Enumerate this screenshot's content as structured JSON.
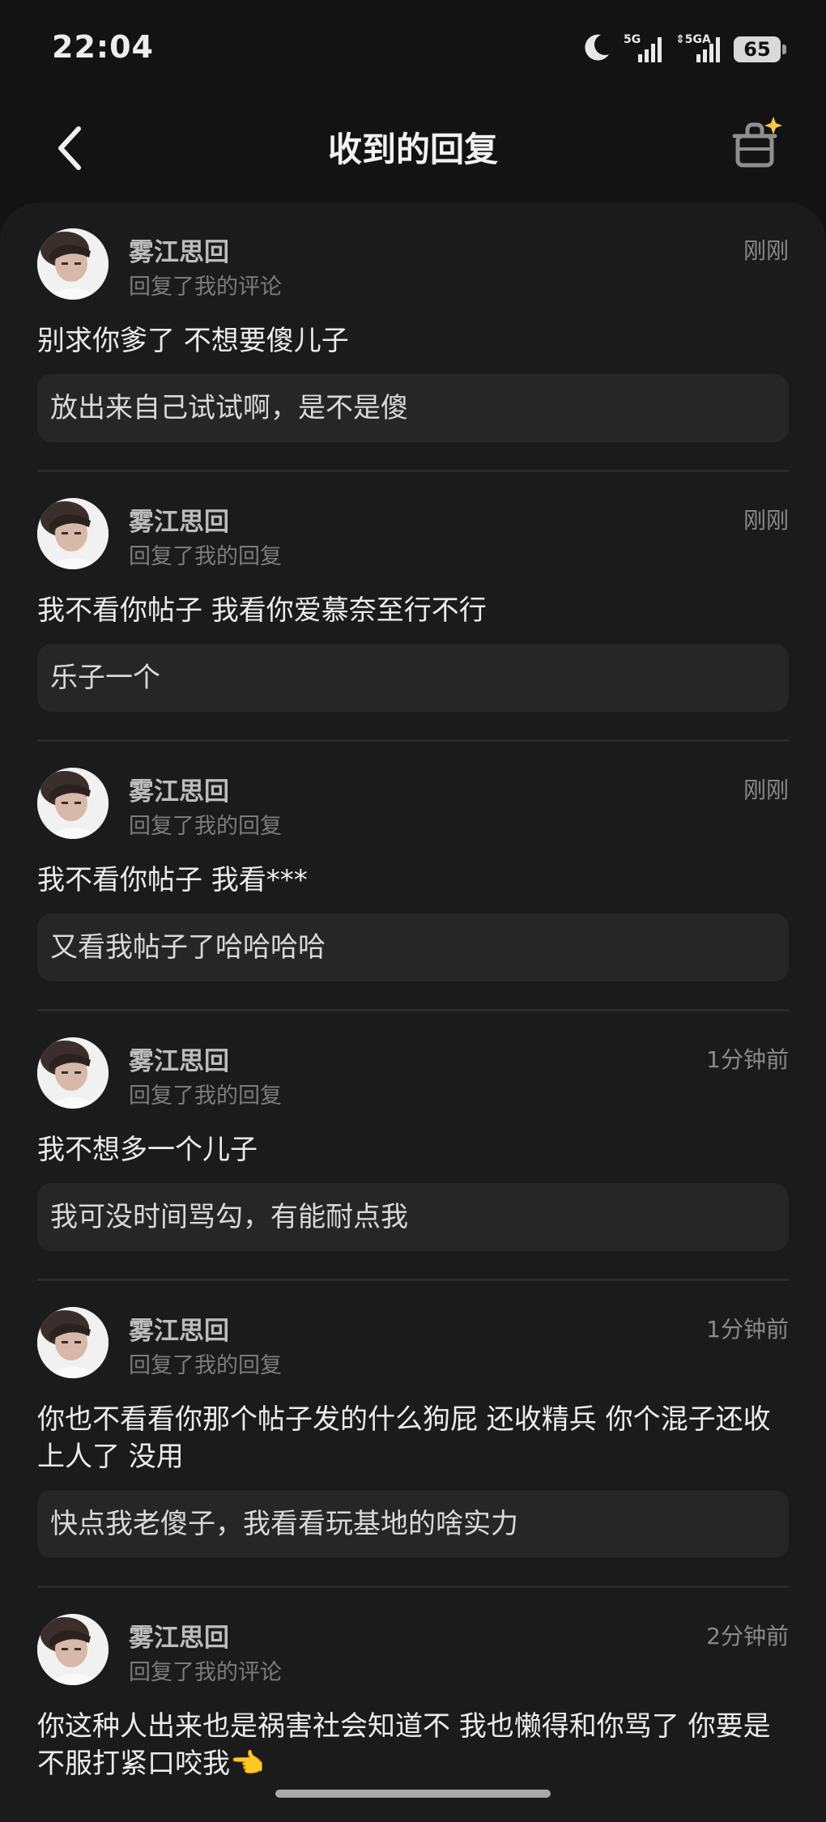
{
  "status_bar": {
    "time": "22:04",
    "battery": "65",
    "network1": "5G",
    "network2": "5GA"
  },
  "header": {
    "title": "收到的回复"
  },
  "replies": [
    {
      "user": "雾江思回",
      "action": "回复了我的评论",
      "time": "刚刚",
      "text": "别求你爹了  不想要傻儿子",
      "quoted": "放出来自己试试啊，是不是傻"
    },
    {
      "user": "雾江思回",
      "action": "回复了我的回复",
      "time": "刚刚",
      "text": "我不看你帖子  我看你爱慕奈至行不行",
      "quoted": "乐子一个"
    },
    {
      "user": "雾江思回",
      "action": "回复了我的回复",
      "time": "刚刚",
      "text": "我不看你帖子  我看***",
      "quoted": "又看我帖子了哈哈哈哈"
    },
    {
      "user": "雾江思回",
      "action": "回复了我的回复",
      "time": "1分钟前",
      "text": "我不想多一个儿子",
      "quoted": "我可没时间骂勾，有能耐点我"
    },
    {
      "user": "雾江思回",
      "action": "回复了我的回复",
      "time": "1分钟前",
      "text": "你也不看看你那个帖子发的什么狗屁  还收精兵  你个混子还收上人了  没用",
      "quoted": "快点我老傻子，我看看玩基地的啥实力"
    },
    {
      "user": "雾江思回",
      "action": "回复了我的评论",
      "time": "2分钟前",
      "text": "你这种人出来也是祸害社会知道不 我也懒得和你骂了 你要是不服打紧口咬我👈",
      "quoted": ""
    }
  ]
}
